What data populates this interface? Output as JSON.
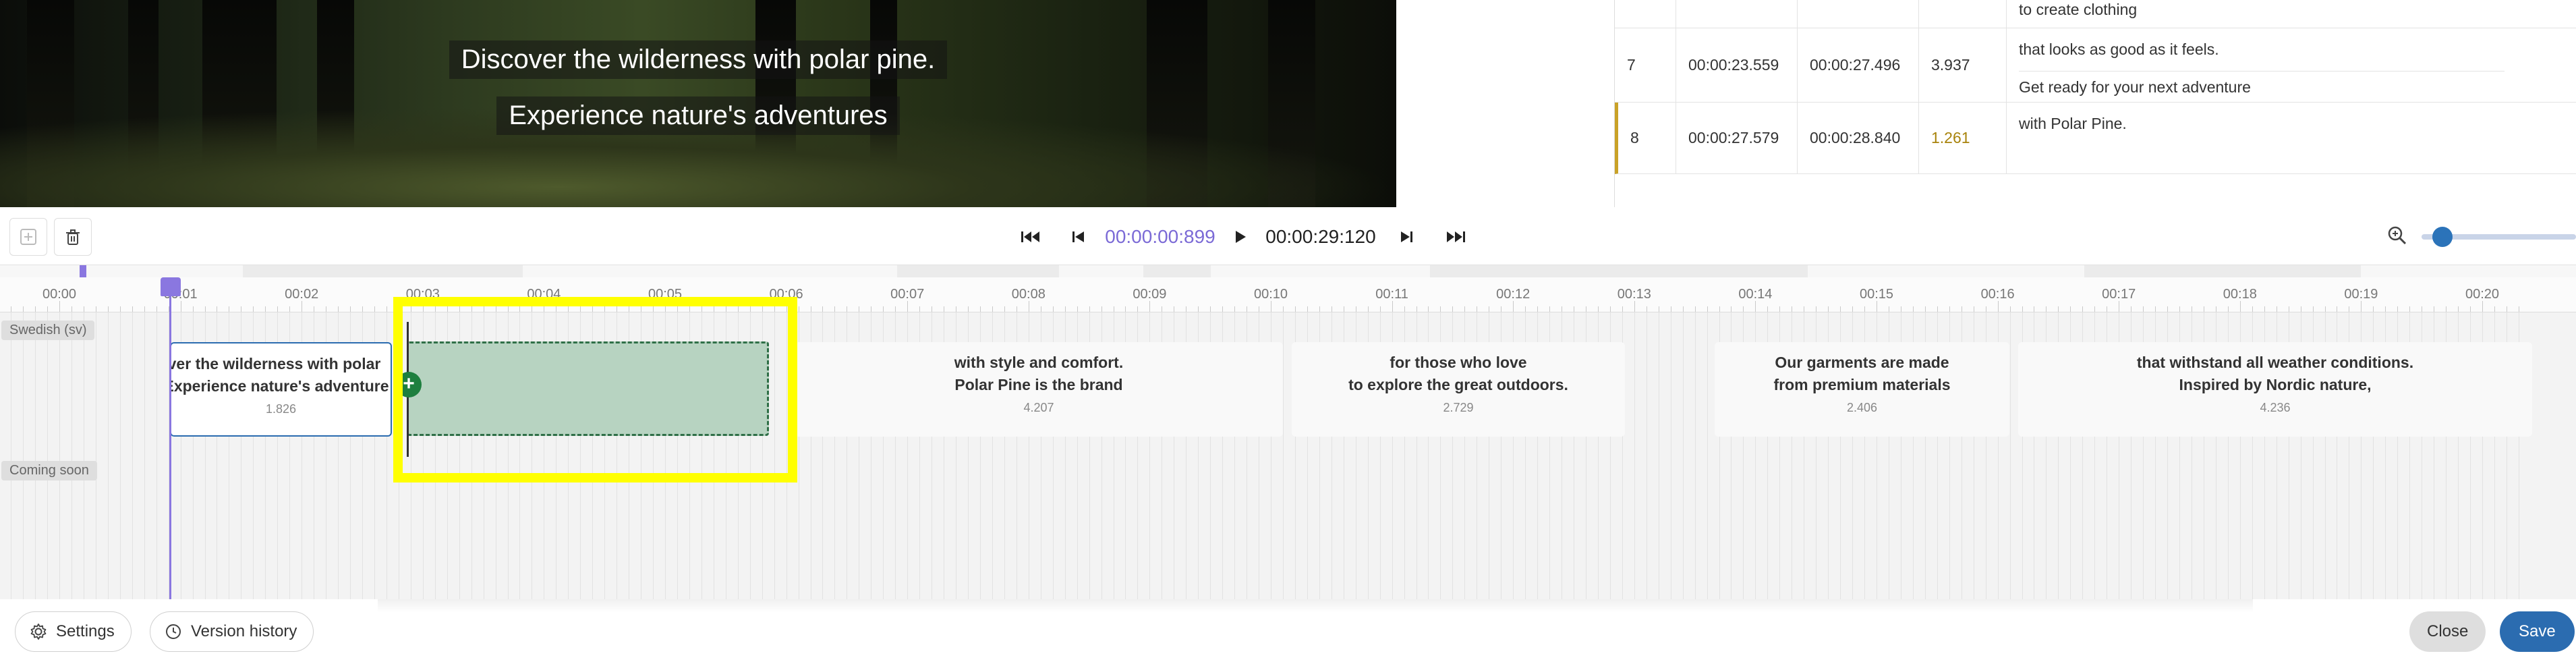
{
  "video": {
    "subtitle_line1": "Discover the wilderness with polar pine.",
    "subtitle_line2": "Experience nature's adventures"
  },
  "table": {
    "rows": [
      {
        "index": "",
        "start": "",
        "end": "",
        "duration": "",
        "text1": "to create clothing",
        "text2": ""
      },
      {
        "index": "7",
        "start": "00:00:23.559",
        "end": "00:00:27.496",
        "duration": "3.937",
        "text1": "that looks as good as it feels.",
        "text2": "Get ready for your next adventure"
      },
      {
        "index": "8",
        "start": "00:00:27.579",
        "end": "00:00:28.840",
        "duration": "1.261",
        "text1": "with Polar Pine.",
        "text2": ""
      }
    ],
    "warning_color": "#a8830c",
    "active_row_color": "#c9a227"
  },
  "toolbar": {
    "add_icon": "plus-square-icon",
    "delete_icon": "trash-icon",
    "skip_start_icon": "skip-to-start-icon",
    "prev_icon": "previous-icon",
    "current_time": "00:00:00:899",
    "play_icon": "play-icon",
    "total_time": "00:00:29:120",
    "next_icon": "next-icon",
    "skip_end_icon": "skip-to-end-icon",
    "zoom_icon": "zoom-in-icon",
    "zoom_level": 0.08
  },
  "timeline": {
    "ticks": [
      "00:00",
      "00:01",
      "00:02",
      "00:03",
      "00:04",
      "00:05",
      "00:06",
      "00:07",
      "00:08",
      "00:09",
      "00:10",
      "00:11",
      "00:12",
      "00:13",
      "00:14",
      "00:15",
      "00:16",
      "00:17",
      "00:18",
      "00:19",
      "00:20"
    ],
    "track1_label": "Swedish (sv)",
    "track2_label": "Coming soon",
    "blocks": [
      {
        "line1": "ver the wilderness with polar",
        "line2": "Experience nature's adventure",
        "duration": "1.826"
      },
      {
        "line1": "with style and comfort.",
        "line2": "Polar Pine is the brand",
        "duration": "4.207"
      },
      {
        "line1": "for those who love",
        "line2": "to explore the great outdoors.",
        "duration": "2.729"
      },
      {
        "line1": "Our garments are made",
        "line2": "from premium materials",
        "duration": "2.406"
      },
      {
        "line1": "that withstand all weather conditions.",
        "line2": "Inspired by Nordic nature,",
        "duration": "4.236"
      }
    ],
    "playhead_color": "#8a77e0",
    "new_block_color": "#b7d3c1",
    "highlight_color": "#ffff00"
  },
  "footer": {
    "settings_label": "Settings",
    "settings_icon": "gear-icon",
    "history_label": "Version history",
    "history_icon": "clock-icon",
    "close_label": "Close",
    "save_label": "Save",
    "save_color": "#2b6cb0"
  }
}
